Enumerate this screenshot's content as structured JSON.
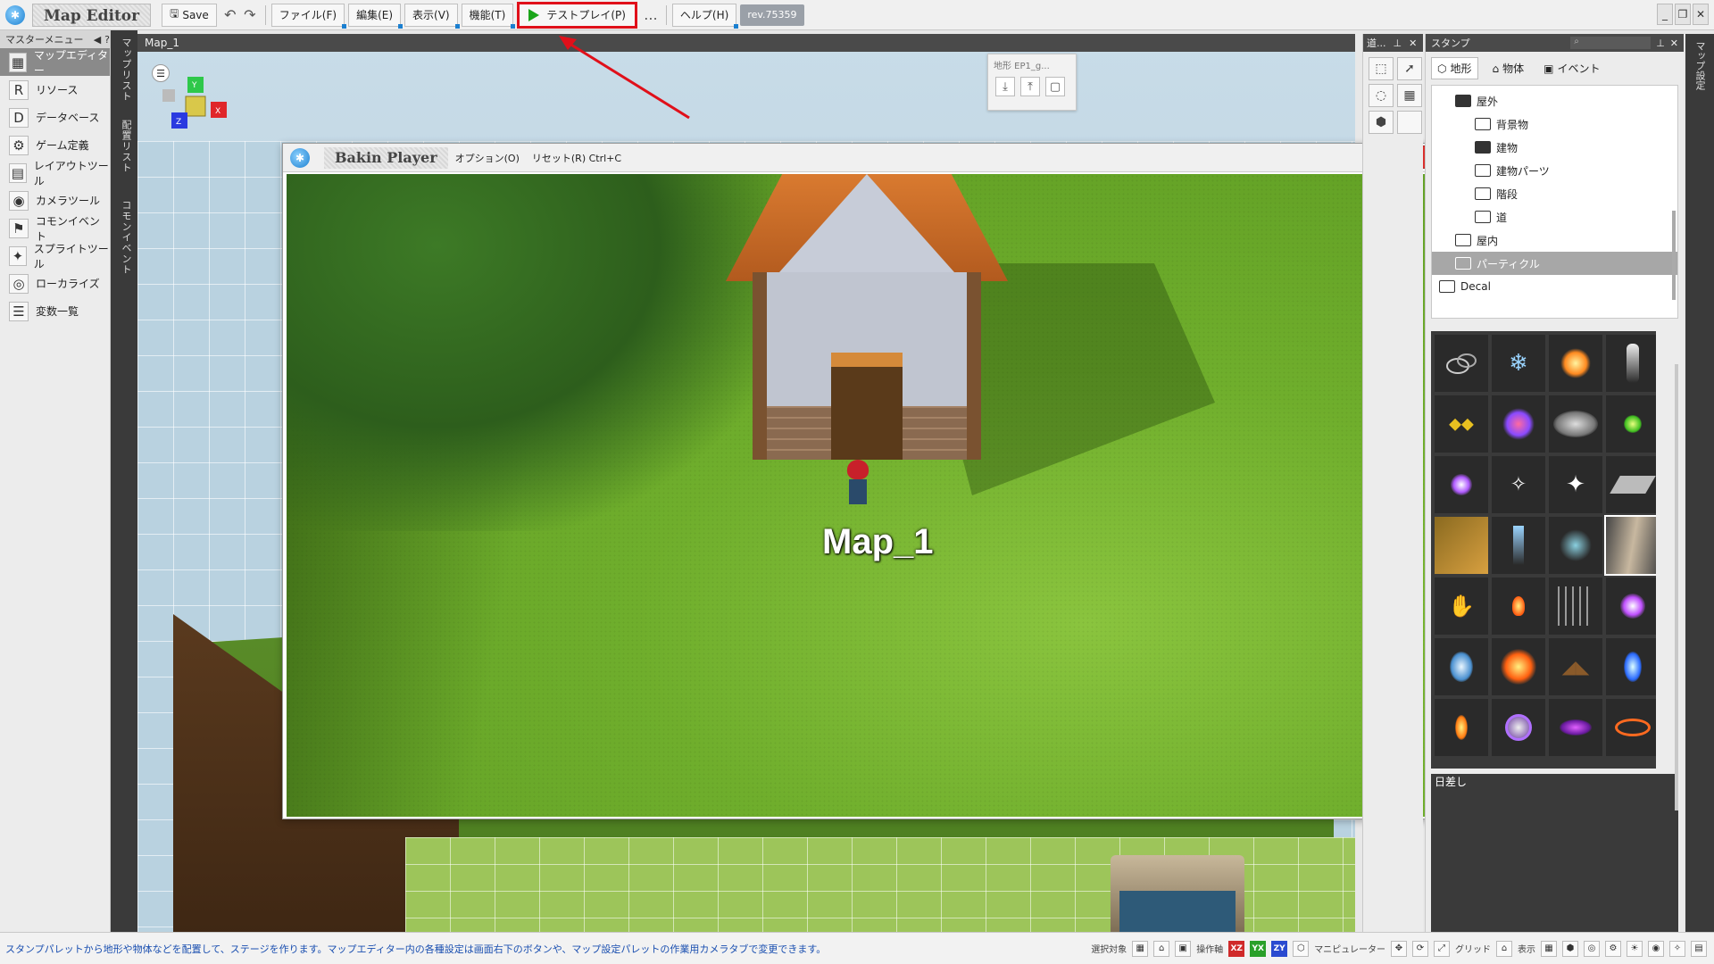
{
  "app": {
    "title": "Map Editor",
    "save_label": "Save",
    "menus": [
      "ファイル(F)",
      "編集(E)",
      "表示(V)",
      "機能(T)"
    ],
    "testplay_label": "テストプレイ(P)",
    "more_label": "...",
    "help_label": "ヘルプ(H)",
    "revision": "rev.75359"
  },
  "master_menu": {
    "title": "マスターメニュー",
    "items": [
      {
        "label": "マップエディター",
        "icon": "map-editor-icon",
        "active": true
      },
      {
        "label": "リソース",
        "icon": "resource-icon",
        "active": false
      },
      {
        "label": "データベース",
        "icon": "database-icon",
        "active": false
      },
      {
        "label": "ゲーム定義",
        "icon": "game-definition-icon",
        "active": false
      },
      {
        "label": "レイアウトツール",
        "icon": "layout-tool-icon",
        "active": false
      },
      {
        "label": "カメラツール",
        "icon": "camera-tool-icon",
        "active": false
      },
      {
        "label": "コモンイベント",
        "icon": "common-event-icon",
        "active": false
      },
      {
        "label": "スプライトツール",
        "icon": "sprite-tool-icon",
        "active": false
      },
      {
        "label": "ローカライズ",
        "icon": "localize-icon",
        "active": false
      },
      {
        "label": "変数一覧",
        "icon": "variables-icon",
        "active": false
      }
    ]
  },
  "vertical_tabs": {
    "map_list": "マップリスト",
    "placement_list": "配置リスト",
    "common_event": "コモンイベント"
  },
  "viewport": {
    "title": "Map_1",
    "terrain_popup_title": "地形 EP1_g..."
  },
  "player": {
    "title": "Bakin Player",
    "option_menu": "オプション(O)",
    "reset_menu": "リセット(R) Ctrl+C",
    "map_label": "Map_1"
  },
  "tools_panel": {
    "title": "道..."
  },
  "stamp_panel": {
    "title": "スタンプ",
    "tabs": [
      "地形",
      "物体",
      "イベント"
    ],
    "tree": [
      {
        "label": "屋外",
        "level": 1,
        "open": true,
        "selected": false
      },
      {
        "label": "背景物",
        "level": 2,
        "open": false,
        "selected": false
      },
      {
        "label": "建物",
        "level": 2,
        "open": true,
        "selected": false
      },
      {
        "label": "建物パーツ",
        "level": 2,
        "open": false,
        "selected": false
      },
      {
        "label": "階段",
        "level": 2,
        "open": false,
        "selected": false
      },
      {
        "label": "道",
        "level": 2,
        "open": false,
        "selected": false
      },
      {
        "label": "屋内",
        "level": 1,
        "open": false,
        "selected": false
      },
      {
        "label": "パーティクル",
        "level": 1,
        "open": false,
        "selected": true
      },
      {
        "label": "Decal",
        "level": 0,
        "open": false,
        "selected": false
      }
    ],
    "selected_stamp_label": "日差し"
  },
  "map_settings_tab": "マップ設定",
  "statusbar": {
    "message": "スタンプパレットから地形や物体などを配置して、ステージを作ります。マップエディター内の各種設定は画面右下のボタンや、マップ設定パレットの作業用カメラタブで変更できます。",
    "select_target": "選択対象",
    "axis_label": "操作軸",
    "axes": [
      "XZ",
      "YX",
      "ZY"
    ],
    "manipulator": "マニピュレーター",
    "grid": "グリッド",
    "display": "表示"
  },
  "colors": {
    "highlight_red": "#e0101a",
    "play_green": "#1aa51a",
    "status_blue": "#1a4fb0"
  }
}
